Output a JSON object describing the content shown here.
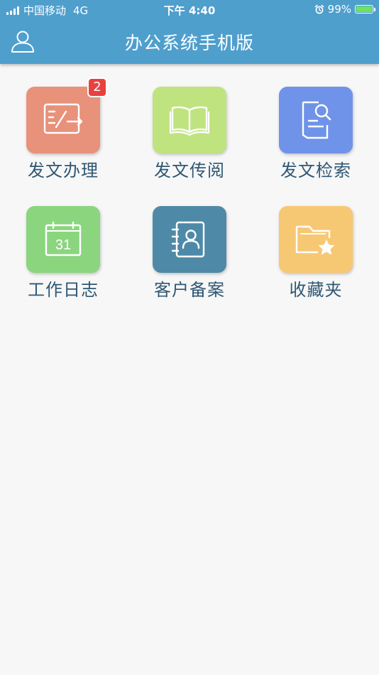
{
  "status_bar": {
    "carrier": "中国移动",
    "network": "4G",
    "time": "下午 4:40",
    "battery_percent": "99%",
    "battery_level": 0.99
  },
  "header": {
    "title": "办公系统手机版",
    "user_icon": "user-icon",
    "background_color": "#4f9fcd"
  },
  "grid": {
    "items": [
      {
        "label": "发文办理",
        "icon": "document-edit-icon",
        "color": "#e8917b",
        "badge": "2"
      },
      {
        "label": "发文传阅",
        "icon": "open-book-icon",
        "color": "#bfe37f"
      },
      {
        "label": "发文检索",
        "icon": "document-search-icon",
        "color": "#6f93e8"
      },
      {
        "label": "工作日志",
        "icon": "calendar-icon",
        "color": "#8bd57f",
        "icon_text": "31"
      },
      {
        "label": "客户备案",
        "icon": "contact-book-icon",
        "color": "#4e8aa8"
      },
      {
        "label": "收藏夹",
        "icon": "star-folder-icon",
        "color": "#f7c873"
      }
    ]
  }
}
